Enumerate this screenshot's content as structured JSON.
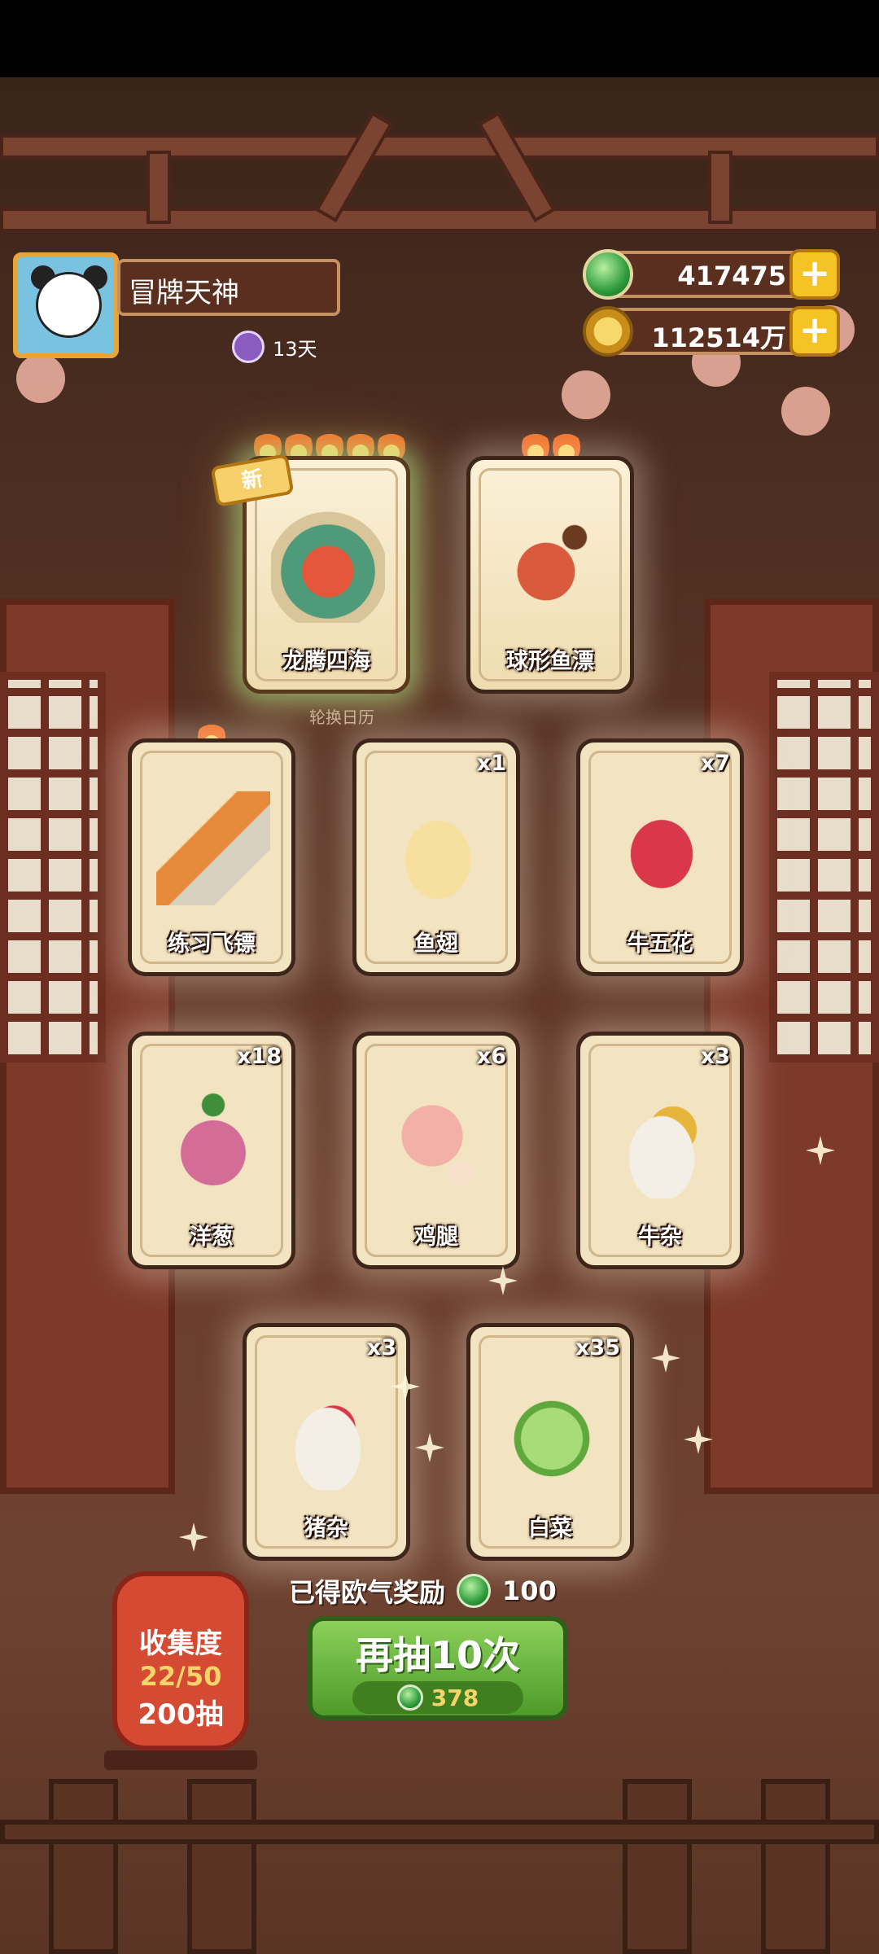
{
  "player": {
    "name": "冒牌天神",
    "days": "13天"
  },
  "currency": {
    "jade": "417475",
    "coins": "112514万"
  },
  "featured": [
    {
      "name": "龙腾四海",
      "badge": "新",
      "flames": 5
    },
    {
      "name": "球形鱼漂",
      "flames": 2
    }
  ],
  "rotation_label": "轮换日历",
  "items": [
    {
      "name": "练习飞镖",
      "count": "",
      "flames": 1
    },
    {
      "name": "鱼翅",
      "count": "x1"
    },
    {
      "name": "牛五花",
      "count": "x7"
    },
    {
      "name": "洋葱",
      "count": "x18"
    },
    {
      "name": "鸡腿",
      "count": "x6"
    },
    {
      "name": "牛杂",
      "count": "x3"
    },
    {
      "name": "猪杂",
      "count": "x3"
    },
    {
      "name": "白菜",
      "count": "x35"
    }
  ],
  "reward": {
    "label": "已得欧气奖励",
    "amount": "100"
  },
  "draw": {
    "label": "再抽10次",
    "cost": "378"
  },
  "collection": {
    "title": "收集度",
    "progress": "22/50",
    "draws": "200抽"
  },
  "colors": {
    "accent_green": "#4e9a2a",
    "gold": "#f6c324",
    "card_bg": "#f3e4c1"
  }
}
